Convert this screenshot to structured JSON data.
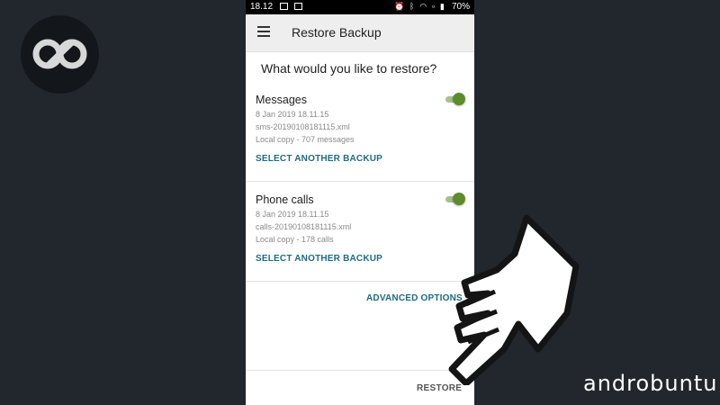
{
  "status_bar": {
    "time": "18.12",
    "battery": "70%"
  },
  "app_bar": {
    "title": "Restore Backup",
    "menu_icon": "hamburger-menu-icon"
  },
  "question": "What would you like to restore?",
  "sections": [
    {
      "title": "Messages",
      "enabled": true,
      "date": "8 Jan 2019 18.11.15",
      "file": "sms-20190108181115.xml",
      "info": "Local copy - 707 messages",
      "link": "SELECT ANOTHER BACKUP"
    },
    {
      "title": "Phone calls",
      "enabled": true,
      "date": "8 Jan 2019 18.11.15",
      "file": "calls-20190108181115.xml",
      "info": "Local copy - 178 calls",
      "link": "SELECT ANOTHER BACKUP"
    }
  ],
  "advanced_options": "ADVANCED OPTIONS",
  "restore_button": "RESTORE",
  "watermark": "androbuntu",
  "colors": {
    "background": "#22272e",
    "accent_link": "#1e6c85",
    "switch_on": "#5d8c2c"
  }
}
